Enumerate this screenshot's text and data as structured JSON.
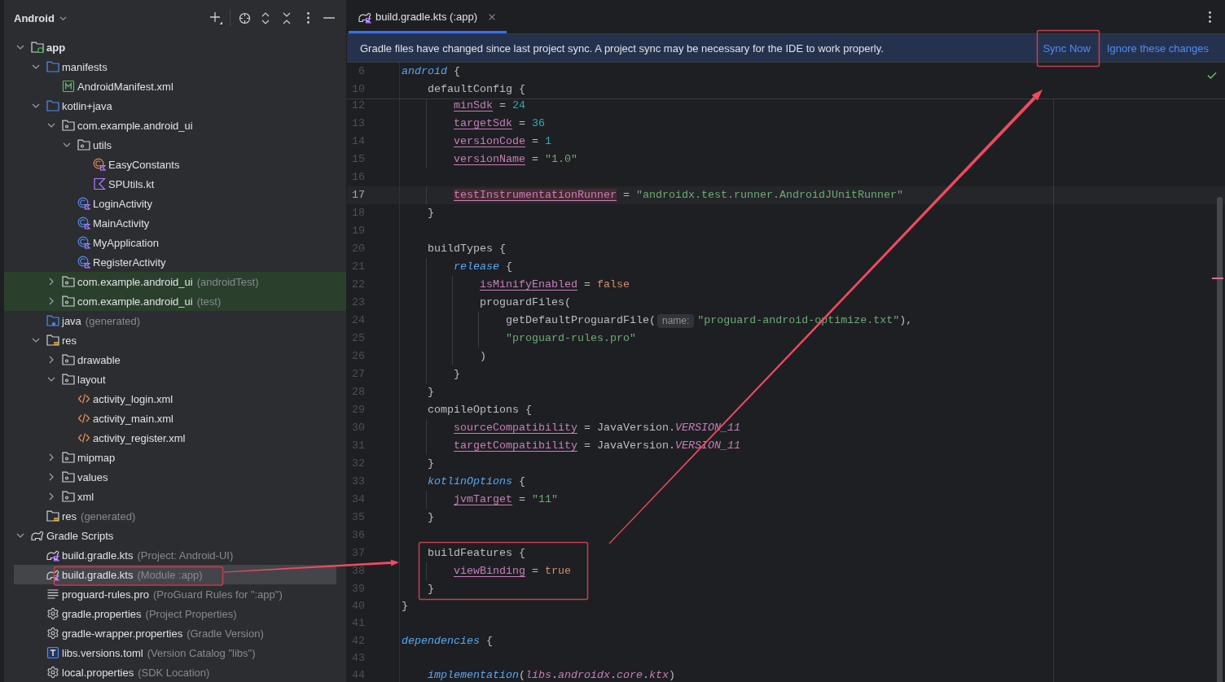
{
  "project_panel": {
    "title": "Android",
    "tree": [
      {
        "name": "app",
        "kind": "module",
        "expanded": true,
        "selected": false,
        "test": false,
        "children": [
          {
            "name": "manifests",
            "kind": "folder",
            "expanded": true,
            "selected": false,
            "test": false,
            "children": [
              {
                "name": "AndroidManifest.xml",
                "kind": "manifest",
                "selected": false,
                "test": false
              }
            ]
          },
          {
            "name": "kotlin+java",
            "kind": "folder",
            "expanded": true,
            "selected": false,
            "test": false,
            "children": [
              {
                "name": "com.example.android_ui",
                "kind": "package",
                "expanded": true,
                "selected": false,
                "test": false,
                "children": [
                  {
                    "name": "utils",
                    "kind": "package",
                    "expanded": true,
                    "selected": false,
                    "test": false,
                    "children": [
                      {
                        "name": "EasyConstants",
                        "kind": "object",
                        "selected": false,
                        "test": false
                      },
                      {
                        "name": "SPUtils.kt",
                        "kind": "kotlin",
                        "selected": false,
                        "test": false
                      }
                    ]
                  },
                  {
                    "name": "LoginActivity",
                    "kind": "class",
                    "selected": false,
                    "test": false
                  },
                  {
                    "name": "MainActivity",
                    "kind": "class",
                    "selected": false,
                    "test": false
                  },
                  {
                    "name": "MyApplication",
                    "kind": "class",
                    "selected": false,
                    "test": false
                  },
                  {
                    "name": "RegisterActivity",
                    "kind": "class",
                    "selected": false,
                    "test": false
                  }
                ]
              },
              {
                "name": "com.example.android_ui",
                "note": "(androidTest)",
                "kind": "package",
                "expanded": false,
                "selected": false,
                "test": true
              },
              {
                "name": "com.example.android_ui",
                "note": "(test)",
                "kind": "package",
                "expanded": false,
                "selected": false,
                "test": true
              }
            ]
          },
          {
            "name": "java",
            "note": "(generated)",
            "kind": "generated",
            "selected": false,
            "test": false
          },
          {
            "name": "res",
            "kind": "resources",
            "expanded": true,
            "selected": false,
            "test": false,
            "children": [
              {
                "name": "drawable",
                "kind": "package",
                "expanded": false,
                "selected": false,
                "test": false
              },
              {
                "name": "layout",
                "kind": "package",
                "expanded": true,
                "selected": false,
                "test": false,
                "children": [
                  {
                    "name": "activity_login.xml",
                    "kind": "xml",
                    "selected": false,
                    "test": false
                  },
                  {
                    "name": "activity_main.xml",
                    "kind": "xml",
                    "selected": false,
                    "test": false
                  },
                  {
                    "name": "activity_register.xml",
                    "kind": "xml",
                    "selected": false,
                    "test": false
                  }
                ]
              },
              {
                "name": "mipmap",
                "kind": "package",
                "expanded": false,
                "selected": false,
                "test": false
              },
              {
                "name": "values",
                "kind": "package",
                "expanded": false,
                "selected": false,
                "test": false
              },
              {
                "name": "xml",
                "kind": "package",
                "expanded": false,
                "selected": false,
                "test": false
              }
            ]
          },
          {
            "name": "res",
            "note": "(generated)",
            "kind": "resources",
            "selected": false,
            "test": false
          }
        ]
      },
      {
        "name": "Gradle Scripts",
        "kind": "scripts",
        "expanded": true,
        "selected": false,
        "test": false,
        "children": [
          {
            "name": "build.gradle.kts",
            "note": "(Project: Android-UI)",
            "kind": "gradle",
            "selected": false,
            "test": false
          },
          {
            "name": "build.gradle.kts",
            "note": "(Module :app)",
            "kind": "gradle",
            "selected": true,
            "test": false
          },
          {
            "name": "proguard-rules.pro",
            "note": "(ProGuard Rules for \":app\")",
            "kind": "text",
            "selected": false,
            "test": false
          },
          {
            "name": "gradle.properties",
            "note": "(Project Properties)",
            "kind": "properties",
            "selected": false,
            "test": false
          },
          {
            "name": "gradle-wrapper.properties",
            "note": "(Gradle Version)",
            "kind": "properties",
            "selected": false,
            "test": false
          },
          {
            "name": "libs.versions.toml",
            "note": "(Version Catalog \"libs\")",
            "kind": "toml",
            "selected": false,
            "test": false
          },
          {
            "name": "local.properties",
            "note": "(SDK Location)",
            "kind": "properties",
            "selected": false,
            "test": false
          }
        ]
      }
    ]
  },
  "editor": {
    "tabs": [
      {
        "label": "build.gradle.kts (:app)",
        "selected": true
      }
    ],
    "banner": {
      "message": "Gradle files have changed since last project sync. A project sync may be necessary for the IDE to work properly.",
      "actions": [
        "Sync Now",
        "Ignore these changes"
      ]
    },
    "sticky_lines": [
      {
        "number": "6",
        "tokens": [
          {
            "text": "android",
            "kind": "block"
          },
          {
            "text": " {",
            "kind": "plain"
          }
        ]
      },
      {
        "number": "10",
        "tokens": [
          {
            "text": "    defaultConfig {",
            "kind": "plain"
          }
        ]
      }
    ],
    "lines": [
      {
        "number": "12",
        "current": false,
        "tokens": [
          {
            "text": "        minSdk",
            "kind": "prop"
          },
          {
            "text": " = ",
            "kind": "plain"
          },
          {
            "text": "24",
            "kind": "number"
          }
        ]
      },
      {
        "number": "13",
        "current": false,
        "tokens": [
          {
            "text": "        targetSdk",
            "kind": "prop"
          },
          {
            "text": " = ",
            "kind": "plain"
          },
          {
            "text": "36",
            "kind": "number"
          }
        ]
      },
      {
        "number": "14",
        "current": false,
        "tokens": [
          {
            "text": "        versionCode",
            "kind": "prop"
          },
          {
            "text": " = ",
            "kind": "plain"
          },
          {
            "text": "1",
            "kind": "number"
          }
        ]
      },
      {
        "number": "15",
        "current": false,
        "tokens": [
          {
            "text": "        versionName",
            "kind": "prop"
          },
          {
            "text": " = ",
            "kind": "plain"
          },
          {
            "text": "\"1.0\"",
            "kind": "string"
          }
        ]
      },
      {
        "number": "16",
        "current": false
      },
      {
        "number": "17",
        "current": true,
        "tokens": [
          {
            "text": "        testInstrumentationRunner",
            "kind": "flagged"
          },
          {
            "text": " = ",
            "kind": "plain"
          },
          {
            "text": "\"androidx.test.runner.AndroidJUnitRunner\"",
            "kind": "string"
          }
        ]
      },
      {
        "number": "18",
        "current": false,
        "tokens": [
          {
            "text": "    }",
            "kind": "plain"
          }
        ]
      },
      {
        "number": "19",
        "current": false
      },
      {
        "number": "20",
        "current": false,
        "tokens": [
          {
            "text": "    buildTypes {",
            "kind": "plain"
          }
        ]
      },
      {
        "number": "21",
        "current": false,
        "tokens": [
          {
            "text": "        release",
            "kind": "block"
          },
          {
            "text": " {",
            "kind": "plain"
          }
        ]
      },
      {
        "number": "22",
        "current": false,
        "tokens": [
          {
            "text": "            isMinifyEnabled",
            "kind": "prop"
          },
          {
            "text": " = ",
            "kind": "plain"
          },
          {
            "text": "false",
            "kind": "keyword"
          }
        ]
      },
      {
        "number": "23",
        "current": false,
        "tokens": [
          {
            "text": "            proguardFiles(",
            "kind": "plain"
          }
        ]
      },
      {
        "number": "24",
        "current": false,
        "tokens": [
          {
            "text": "                getDefaultProguardFile(",
            "kind": "plain"
          },
          {
            "text": "name:",
            "kind": "hint"
          },
          {
            "text": "\"proguard-android-optimize.txt\"",
            "kind": "string"
          },
          {
            "text": "),",
            "kind": "plain"
          }
        ]
      },
      {
        "number": "25",
        "current": false,
        "tokens": [
          {
            "text": "                \"proguard-rules.pro\"",
            "kind": "string"
          }
        ]
      },
      {
        "number": "26",
        "current": false,
        "tokens": [
          {
            "text": "            )",
            "kind": "plain"
          }
        ]
      },
      {
        "number": "27",
        "current": false,
        "tokens": [
          {
            "text": "        }",
            "kind": "plain"
          }
        ]
      },
      {
        "number": "28",
        "current": false,
        "tokens": [
          {
            "text": "    }",
            "kind": "plain"
          }
        ]
      },
      {
        "number": "29",
        "current": false,
        "tokens": [
          {
            "text": "    compileOptions {",
            "kind": "plain"
          }
        ]
      },
      {
        "number": "30",
        "current": false,
        "tokens": [
          {
            "text": "        sourceCompatibility",
            "kind": "prop"
          },
          {
            "text": " = JavaVersion.",
            "kind": "plain"
          },
          {
            "text": "VERSION_11",
            "kind": "constant"
          }
        ]
      },
      {
        "number": "31",
        "current": false,
        "tokens": [
          {
            "text": "        targetCompatibility",
            "kind": "prop"
          },
          {
            "text": " = JavaVersion.",
            "kind": "plain"
          },
          {
            "text": "VERSION_11",
            "kind": "constant"
          }
        ]
      },
      {
        "number": "32",
        "current": false,
        "tokens": [
          {
            "text": "    }",
            "kind": "plain"
          }
        ]
      },
      {
        "number": "33",
        "current": false,
        "tokens": [
          {
            "text": "    kotlinOptions",
            "kind": "block"
          },
          {
            "text": " {",
            "kind": "plain"
          }
        ]
      },
      {
        "number": "34",
        "current": false,
        "tokens": [
          {
            "text": "        jvmTarget",
            "kind": "prop"
          },
          {
            "text": " = ",
            "kind": "plain"
          },
          {
            "text": "\"11\"",
            "kind": "string"
          }
        ]
      },
      {
        "number": "35",
        "current": false,
        "tokens": [
          {
            "text": "    }",
            "kind": "plain"
          }
        ]
      },
      {
        "number": "36",
        "current": false
      },
      {
        "number": "37",
        "current": false,
        "tokens": [
          {
            "text": "    buildFeatures {",
            "kind": "plain"
          }
        ]
      },
      {
        "number": "38",
        "current": false,
        "tokens": [
          {
            "text": "        viewBinding",
            "kind": "prop"
          },
          {
            "text": " = ",
            "kind": "plain"
          },
          {
            "text": "true",
            "kind": "keyword"
          }
        ]
      },
      {
        "number": "39",
        "current": false,
        "tokens": [
          {
            "text": "    }",
            "kind": "plain"
          }
        ]
      },
      {
        "number": "40",
        "current": false,
        "tokens": [
          {
            "text": "}",
            "kind": "plain"
          }
        ]
      },
      {
        "number": "41",
        "current": false
      },
      {
        "number": "42",
        "current": false,
        "tokens": [
          {
            "text": "dependencies",
            "kind": "block"
          },
          {
            "text": " {",
            "kind": "plain"
          }
        ]
      },
      {
        "number": "43",
        "current": false
      },
      {
        "number": "44",
        "current": false,
        "tokens": [
          {
            "text": "    implementation",
            "kind": "block"
          },
          {
            "text": "(",
            "kind": "plain"
          },
          {
            "text": "libs",
            "kind": "constant"
          },
          {
            "text": ".",
            "kind": "plain"
          },
          {
            "text": "androidx",
            "kind": "constant"
          },
          {
            "text": ".",
            "kind": "plain"
          },
          {
            "text": "core",
            "kind": "constant"
          },
          {
            "text": ".",
            "kind": "plain"
          },
          {
            "text": "ktx",
            "kind": "constant"
          },
          {
            "text": ")",
            "kind": "plain"
          }
        ]
      }
    ]
  }
}
